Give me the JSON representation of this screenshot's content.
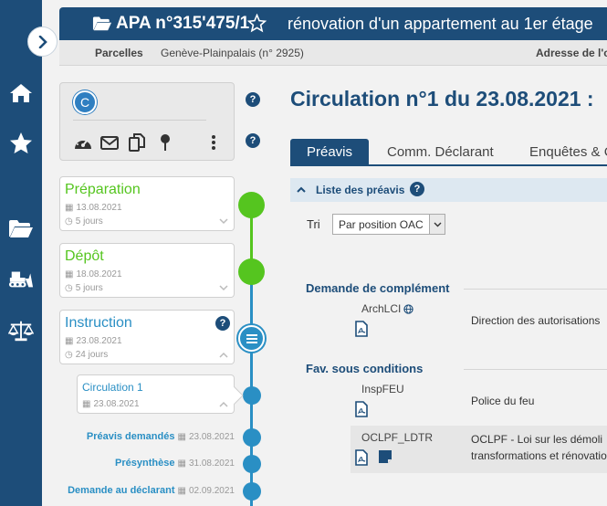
{
  "header": {
    "dossier": "APA n°315'475/1",
    "subject": "rénovation d'un appartement au 1er étage",
    "parcelles_label": "Parcelles",
    "parcelles_value": "Genève-Plainpalais (n° 2925)",
    "adresse_label": "Adresse de l'o"
  },
  "user": {
    "initial": "C"
  },
  "help_glyph": "?",
  "timeline": {
    "steps": [
      {
        "title": "Préparation",
        "date": "13.08.2021",
        "duration": "5 jours",
        "color": "#55c51f"
      },
      {
        "title": "Dépôt",
        "date": "18.08.2021",
        "duration": "5 jours",
        "color": "#55c51f"
      },
      {
        "title": "Instruction",
        "date": "23.08.2021",
        "duration": "24 jours",
        "color": "#2a8fc4"
      }
    ],
    "circulation": {
      "title": "Circulation 1",
      "date": "23.08.2021"
    },
    "subitems": [
      {
        "name": "Préavis demandés",
        "date": "23.08.2021"
      },
      {
        "name": "Présynthèse",
        "date": "31.08.2021"
      },
      {
        "name": "Demande au déclarant",
        "date": "02.09.2021"
      }
    ]
  },
  "main": {
    "title": "Circulation n°1 du 23.08.2021 :",
    "tabs": [
      "Préavis",
      "Comm. Déclarant",
      "Enquêtes & C"
    ],
    "section_label": "Liste des préavis",
    "sort_label": "Tri",
    "sort_value": "Par position OAC",
    "groups": [
      {
        "title": "Demande de complément",
        "rows": [
          {
            "code": "ArchLCI",
            "desc1": "Direction des autorisations",
            "desc2": ""
          }
        ]
      },
      {
        "title": "Fav. sous conditions",
        "rows": [
          {
            "code": "InspFEU",
            "desc1": "Police du feu",
            "desc2": ""
          },
          {
            "code": "OCLPF_LDTR",
            "desc1": "OCLPF - Loi sur les démoli",
            "desc2": "transformations et rénovatio"
          }
        ]
      }
    ]
  },
  "colors": {
    "primary": "#1d4d79",
    "done": "#55c51f",
    "current": "#2a8fc4"
  }
}
